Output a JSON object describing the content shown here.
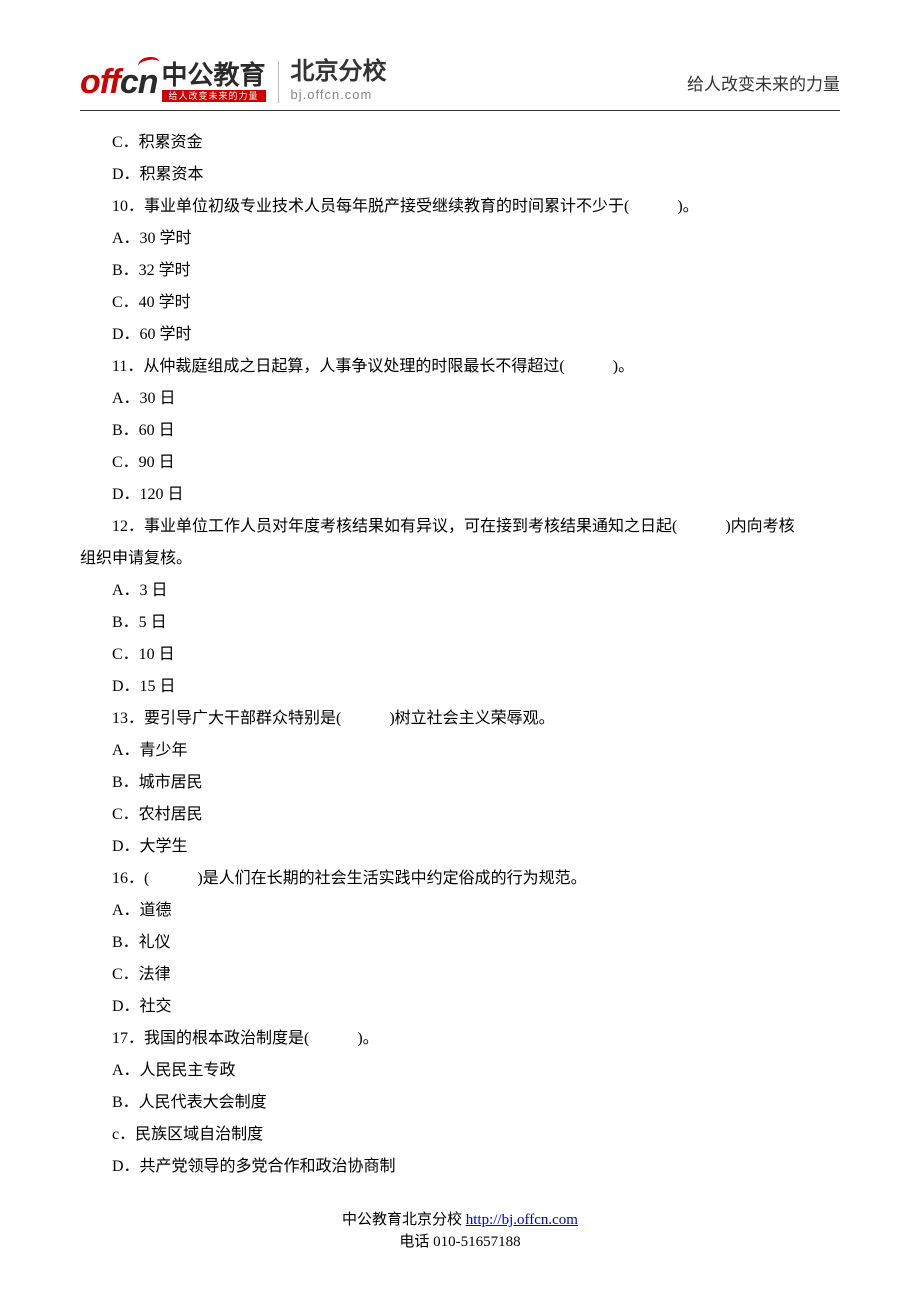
{
  "header": {
    "logo_en": "off",
    "logo_en2": "cn",
    "brand_cn": "中公教育",
    "brand_sub": "给人改变未来的力量",
    "branch_main": "北京分校",
    "branch_sub": "bj.offcn.com",
    "slogan": "给人改变未来的力量"
  },
  "body_lines": [
    {
      "t": "C．积累资金"
    },
    {
      "t": "D．积累资本"
    },
    {
      "t": "10．事业单位初级专业技术人员每年脱产接受继续教育的时间累计不少于(　　　)。"
    },
    {
      "t": "A．30 学时"
    },
    {
      "t": "B．32 学时"
    },
    {
      "t": "C．40 学时"
    },
    {
      "t": "D．60 学时"
    },
    {
      "t": "11．从仲裁庭组成之日起算，人事争议处理的时限最长不得超过(　　　)。"
    },
    {
      "t": "A．30 日"
    },
    {
      "t": "B．60 日"
    },
    {
      "t": "C．90 日"
    },
    {
      "t": "D．120 日"
    },
    {
      "t": "12．事业单位工作人员对年度考核结果如有异议，可在接到考核结果通知之日起(　　　)内向考核"
    },
    {
      "t": "组织申请复核。",
      "cont": true
    },
    {
      "t": "A．3 日"
    },
    {
      "t": "B．5 日"
    },
    {
      "t": "C．10 日"
    },
    {
      "t": "D．15 日"
    },
    {
      "t": "13．要引导广大干部群众特别是(　　　)树立社会主义荣辱观。"
    },
    {
      "t": "A．青少年"
    },
    {
      "t": "B．城市居民"
    },
    {
      "t": "C．农村居民"
    },
    {
      "t": "D．大学生"
    },
    {
      "t": "16．(　　　)是人们在长期的社会生活实践中约定俗成的行为规范。"
    },
    {
      "t": "A．道德"
    },
    {
      "t": "B．礼仪"
    },
    {
      "t": "C．法律"
    },
    {
      "t": "D．社交"
    },
    {
      "t": "17．我国的根本政治制度是(　　　)。"
    },
    {
      "t": "A．人民民主专政"
    },
    {
      "t": "B．人民代表大会制度"
    },
    {
      "t": "c．民族区域自治制度"
    },
    {
      "t": "D．共产党领导的多党合作和政治协商制"
    }
  ],
  "footer": {
    "line1_prefix": "中公教育北京分校",
    "link_text": "http://bj.offcn.com",
    "line2": "电话 010-51657188"
  }
}
